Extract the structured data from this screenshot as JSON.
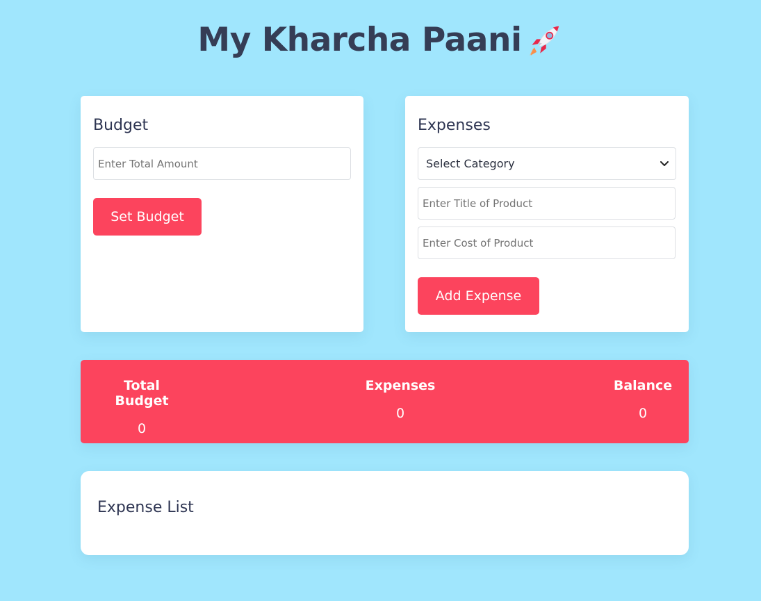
{
  "app": {
    "title": "My Kharcha Paani",
    "title_icon": "rocket-icon"
  },
  "budget": {
    "heading": "Budget",
    "amount_placeholder": "Enter Total Amount",
    "amount_value": "",
    "set_button": "Set Budget"
  },
  "expenses": {
    "heading": "Expenses",
    "category_selected": "Select Category",
    "title_placeholder": "Enter Title of Product",
    "cost_placeholder": "Enter Cost of Product",
    "add_button": "Add Expense"
  },
  "summary": {
    "total_budget_label": "Total Budget",
    "total_budget_value": "0",
    "expenses_label": "Expenses",
    "expenses_value": "0",
    "balance_label": "Balance",
    "balance_value": "0"
  },
  "expense_list": {
    "heading": "Expense List",
    "items": []
  },
  "colors": {
    "background": "#a0e6fd",
    "accent": "#fc445d",
    "card": "#ffffff",
    "heading_text": "#353d55"
  }
}
